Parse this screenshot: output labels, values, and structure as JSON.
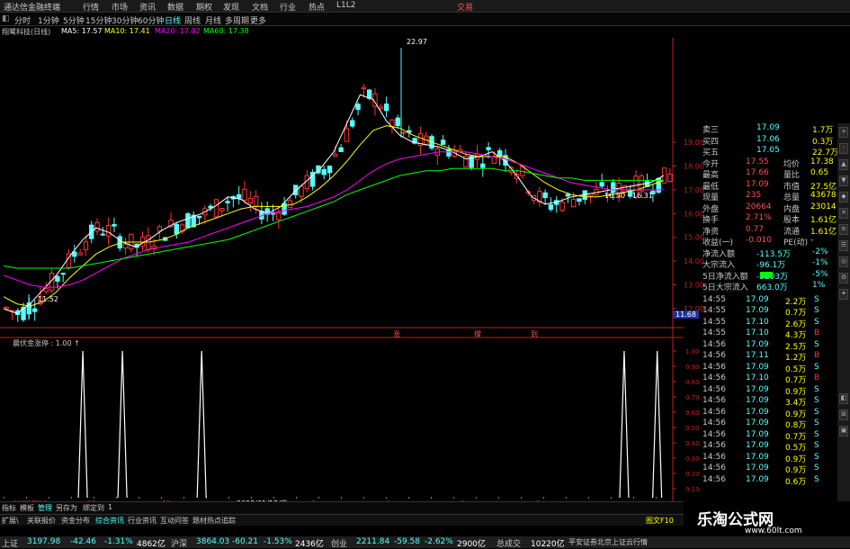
{
  "app": {
    "title": "通达信金融终端",
    "menus": [
      "行情",
      "市场",
      "资讯",
      "数据",
      "期权",
      "发现",
      "文档",
      "行业",
      "热点",
      "L1L2"
    ],
    "trade_label": "交易"
  },
  "toolbar": {
    "periods": [
      "分时",
      "1分钟",
      "5分钟",
      "15分钟",
      "30分钟",
      "60分钟",
      "日线",
      "周线",
      "月线",
      "多周期",
      "更多"
    ],
    "active": "日线"
  },
  "info": {
    "stock": "翔鹭科技(日线)",
    "ma5": "MA5: 17.57",
    "ma10": "MA10: 17.41",
    "ma20": "MA20: 17.02",
    "ma60": "MA60: 17.38"
  },
  "colors": {
    "up": "#ff3232",
    "down": "#54ffff",
    "ma5": "#ffffff",
    "ma10": "#ffff00",
    "ma20": "#ff00ff",
    "ma60": "#00ff00",
    "axis_red": "#c02020"
  },
  "chart_data": [
    {
      "type": "candlestick",
      "title": "翔鹭科技(日线)",
      "ylim": [
        11.2,
        23.4
      ],
      "y_ticks": [
        "19.00",
        "18.00",
        "17.00",
        "16.00",
        "15.00",
        "14.00",
        "13.00",
        "12.00"
      ],
      "current_price_tag": "11.68",
      "annotations": [
        "22.97",
        "11.52",
        "16.30 - 16.31"
      ],
      "series": [
        {
          "name": "MA5",
          "values": [
            12.0,
            11.8,
            12.2,
            12.8,
            13.4,
            14.2,
            14.9,
            15.4,
            15.2,
            14.8,
            14.6,
            14.9,
            15.3,
            15.6,
            15.8,
            16.0,
            16.3,
            16.7,
            16.6,
            16.2,
            16.0,
            16.3,
            16.9,
            17.4,
            17.9,
            18.6,
            19.8,
            21.0,
            20.8,
            19.9,
            19.3,
            19.0,
            18.9,
            18.8,
            18.6,
            18.3,
            18.4,
            18.6,
            18.2,
            17.5,
            16.7,
            16.4,
            16.5,
            16.7,
            16.8,
            16.9,
            17.0,
            17.1,
            17.2,
            17.3,
            17.6
          ]
        },
        {
          "name": "MA10",
          "values": [
            12.5,
            12.2,
            12.1,
            12.3,
            12.7,
            13.3,
            13.8,
            14.3,
            14.6,
            14.8,
            14.8,
            14.8,
            14.9,
            15.1,
            15.4,
            15.6,
            15.8,
            16.0,
            16.2,
            16.3,
            16.3,
            16.3,
            16.4,
            16.7,
            17.1,
            17.6,
            18.2,
            18.9,
            19.5,
            19.7,
            19.6,
            19.3,
            19.1,
            18.9,
            18.7,
            18.5,
            18.4,
            18.4,
            18.4,
            18.1,
            17.7,
            17.3,
            17.0,
            16.8,
            16.7,
            16.7,
            16.8,
            16.9,
            17.0,
            17.2,
            17.4
          ]
        },
        {
          "name": "MA20",
          "values": [
            13.4,
            13.2,
            13.0,
            12.9,
            12.9,
            13.0,
            13.2,
            13.5,
            13.8,
            14.1,
            14.3,
            14.5,
            14.6,
            14.7,
            14.8,
            15.0,
            15.2,
            15.4,
            15.6,
            15.8,
            16.0,
            16.1,
            16.2,
            16.3,
            16.5,
            16.7,
            17.0,
            17.4,
            17.8,
            18.1,
            18.3,
            18.4,
            18.5,
            18.6,
            18.6,
            18.6,
            18.5,
            18.4,
            18.3,
            18.1,
            17.9,
            17.7,
            17.5,
            17.3,
            17.2,
            17.1,
            17.0,
            17.0,
            17.0,
            17.0,
            17.0
          ]
        },
        {
          "name": "MA60",
          "values": [
            13.8,
            13.7,
            13.7,
            13.7,
            13.7,
            13.7,
            13.8,
            13.9,
            14.0,
            14.1,
            14.2,
            14.3,
            14.4,
            14.5,
            14.6,
            14.7,
            14.8,
            14.9,
            15.1,
            15.3,
            15.5,
            15.7,
            15.9,
            16.1,
            16.3,
            16.5,
            16.8,
            17.0,
            17.2,
            17.4,
            17.6,
            17.7,
            17.8,
            17.8,
            17.9,
            17.9,
            17.9,
            17.9,
            17.8,
            17.8,
            17.7,
            17.6,
            17.5,
            17.5,
            17.4,
            17.4,
            17.4,
            17.4,
            17.4,
            17.4,
            17.4
          ]
        }
      ]
    },
    {
      "type": "line",
      "title": "晨伏金涨停 : 1.00 ↑",
      "ylim": [
        0,
        1
      ],
      "y_ticks": [
        "1.00",
        "0.90",
        "0.80",
        "0.70",
        "0.60",
        "0.50",
        "0.40",
        "0.30",
        "0.20",
        "0.10"
      ],
      "x_ticks": [
        "2022年10",
        "11",
        "12",
        "2023/01/18/三",
        "3",
        "4",
        "5",
        "6"
      ],
      "spikes_at_fraction": [
        0.12,
        0.18,
        0.3,
        0.94,
        0.99
      ]
    }
  ],
  "markers": [
    "涨",
    "撑",
    "到"
  ],
  "right_panel": {
    "rows": [
      {
        "label": "卖三",
        "v1": "17.09",
        "v2": "1.7万"
      },
      {
        "label": "买四",
        "v1": "17.06",
        "v2": "0.3万"
      },
      {
        "label": "买五",
        "v1": "17.05",
        "v2": "22.7万"
      },
      {
        "label": "今开",
        "v1": "17.55",
        "label2": "均价",
        "v2": "17.38"
      },
      {
        "label": "最高",
        "v1": "17.66",
        "label2": "量比",
        "v2": "0.65"
      },
      {
        "label": "最低",
        "v1": "17.09",
        "label2": "市值",
        "v2": "27.5亿"
      },
      {
        "label": "现量",
        "v1": "235",
        "label2": "总量",
        "v2": "43678"
      },
      {
        "label": "外盘",
        "v1": "20664",
        "label2": "内盘",
        "v2": "23014"
      },
      {
        "label": "换手",
        "v1": "2.71%",
        "label2": "股本",
        "v2": "1.61亿"
      },
      {
        "label": "净资",
        "v1": "0.77",
        "label2": "流通",
        "v2": "1.61亿"
      },
      {
        "label": "收益(一)",
        "v1": "-0.010",
        "label2": "PE(动)",
        "v2": "-"
      },
      {
        "label": "净流入额",
        "v1": "-113.5万",
        "v2": "-2%"
      },
      {
        "label": "大宗流入",
        "v1": "-96.1万",
        "v2": "-1%"
      },
      {
        "label": "5日净流入额",
        "v1": "-3203万",
        "v2": "-5%"
      },
      {
        "label": "5日大宗流入",
        "v1": "663.0万",
        "v2": "1%"
      }
    ],
    "ticks": [
      {
        "t": "14:55",
        "p": "17.09",
        "v": "2.2万",
        "d": "S"
      },
      {
        "t": "14:55",
        "p": "17.09",
        "v": "0.7万",
        "d": "S"
      },
      {
        "t": "14:55",
        "p": "17.10",
        "v": "2.6万",
        "d": "S"
      },
      {
        "t": "14:55",
        "p": "17.10",
        "v": "4.3万",
        "d": "B"
      },
      {
        "t": "14:56",
        "p": "17.09",
        "v": "2.5万",
        "d": "S"
      },
      {
        "t": "14:56",
        "p": "17.11",
        "v": "1.2万",
        "d": "B"
      },
      {
        "t": "14:56",
        "p": "17.09",
        "v": "0.5万",
        "d": "S"
      },
      {
        "t": "14:56",
        "p": "17.10",
        "v": "0.7万",
        "d": "B"
      },
      {
        "t": "14:56",
        "p": "17.09",
        "v": "0.9万",
        "d": "S"
      },
      {
        "t": "14:56",
        "p": "17.09",
        "v": "3.4万",
        "d": "S"
      },
      {
        "t": "14:56",
        "p": "17.09",
        "v": "0.9万",
        "d": "S"
      },
      {
        "t": "14:56",
        "p": "17.09",
        "v": "0.8万",
        "d": "S"
      },
      {
        "t": "14:56",
        "p": "17.09",
        "v": "0.7万",
        "d": "S"
      },
      {
        "t": "14:56",
        "p": "17.09",
        "v": "0.5万",
        "d": "S"
      },
      {
        "t": "14:56",
        "p": "17.09",
        "v": "0.9万",
        "d": "S"
      },
      {
        "t": "14:56",
        "p": "17.09",
        "v": "0.9万",
        "d": "S"
      },
      {
        "t": "14:56",
        "p": "17.09",
        "v": "0.6万",
        "d": "S"
      }
    ]
  },
  "bottom_tabs": [
    "指标",
    "模板",
    "管理",
    "另存为",
    "绑定到",
    "1"
  ],
  "bottom_links": [
    "扩展\\",
    "关联报价",
    "资金分布",
    "综合资讯",
    "行业资讯",
    "互动问答",
    "题材热点追踪"
  ],
  "bottom_right": "图文F10",
  "status": {
    "sh_label": "上证",
    "sh_val": "3197.98",
    "sh_chg": "-42.46",
    "sh_pct": "-1.31%",
    "sh_amt": "4862亿",
    "hs_label": "沪深",
    "hs_val": "3864.03",
    "hs_chg": "-60.21",
    "hs_pct": "-1.53%",
    "hs_amt": "2436亿",
    "cy_label": "创业",
    "cy_val": "2211.84",
    "cy_chg": "-59.58",
    "cy_pct": "-2.62%",
    "cy_amt": "2900亿",
    "total_label": "总成交",
    "total": "10220亿",
    "broker": "平安证券北京上证云行情"
  },
  "watermark": {
    "title": "乐淘公式网",
    "url": "www.60lt.com"
  }
}
